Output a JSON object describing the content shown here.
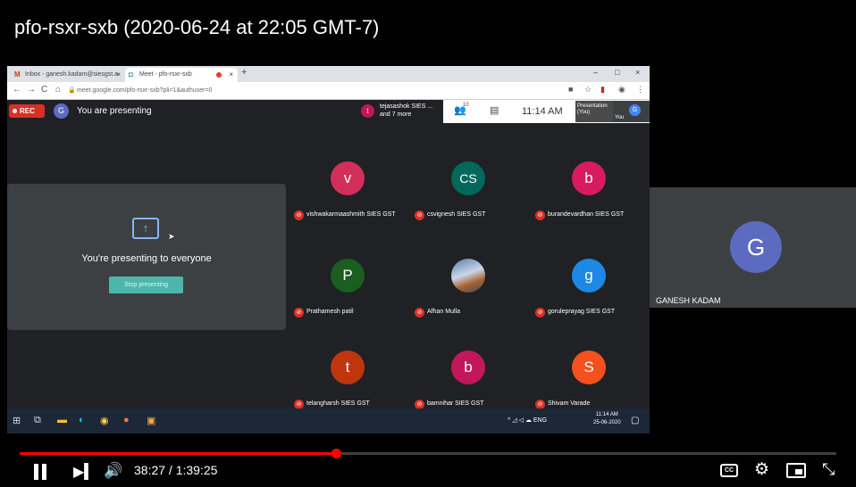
{
  "video": {
    "title": "pfo-rsxr-sxb (2020-06-24 at 22:05 GMT-7)"
  },
  "browser": {
    "tabs": [
      {
        "label": "Inbox - ganesh.kadam@siesgst.a",
        "icon": "gmail-icon",
        "icon_glyph": "M"
      },
      {
        "label": "Meet - pfo-rsxr-sxb",
        "icon": "meet-icon",
        "icon_glyph": "◘"
      }
    ],
    "new_tab": "+",
    "close": "×",
    "window_controls": [
      "–",
      "□",
      "×"
    ],
    "url": "meet.google.com/pfo-rsxr-sxb?pli=1&authuser=0"
  },
  "meet": {
    "rec_label": "REC",
    "me_initial": "G",
    "presenting_label": "You are presenting",
    "people_pill": {
      "initial": "t",
      "line1": "tejasashok SIES ...",
      "line2": "and 7 more"
    },
    "people_count": "10",
    "clock": "11:14 AM",
    "presentation_thumb": {
      "line1": "Presentation",
      "line2": "(You)"
    },
    "you_label": "You",
    "you_initial": "G",
    "present_message": "You're presenting to everyone",
    "stop_button": "Stop presenting",
    "participants": [
      {
        "initial": "v",
        "name": "vishwakarmaashmith SIES GST",
        "color": "#d32f5b"
      },
      {
        "initial": "CS",
        "name": "csvignesh SIES GST",
        "color": "#00695c"
      },
      {
        "initial": "b",
        "name": "burandevardhan SIES GST",
        "color": "#d81b60"
      },
      {
        "initial": "P",
        "name": "Prathamesh patil",
        "color": "#1b5e20"
      },
      {
        "initial": "",
        "name": "Afhan Mulla",
        "color": "#5a7ba8",
        "photo": true
      },
      {
        "initial": "g",
        "name": "goruleprayag SIES GST",
        "color": "#1e88e5"
      },
      {
        "initial": "t",
        "name": "telangharsh SIES GST",
        "color": "#bf360c"
      },
      {
        "initial": "b",
        "name": "bamnihar SIES GST",
        "color": "#c2185b"
      },
      {
        "initial": "S",
        "name": "Shivam Varade",
        "color": "#f4511e"
      }
    ]
  },
  "taskbar": {
    "language": "ENG",
    "time": "11:14 AM",
    "date": "25-06-2020"
  },
  "side_tile": {
    "initial": "G",
    "name": "GANESH KADAM"
  },
  "player": {
    "current_time": "38:27",
    "duration": "1:39:25",
    "time_display": "38:27 / 1:39:25",
    "progress_fraction": 0.387,
    "cc_label": "CC"
  }
}
